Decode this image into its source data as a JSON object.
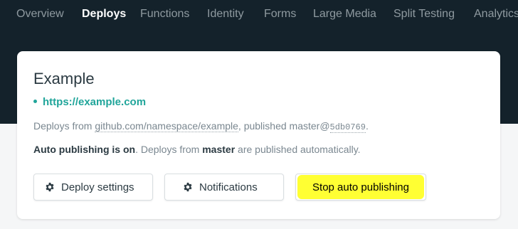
{
  "colors": {
    "top_background": "#14222b",
    "accent_teal": "#20a59a",
    "highlight_yellow": "#ffff33"
  },
  "nav": {
    "items": [
      {
        "label": "Overview"
      },
      {
        "label": "Deploys",
        "active": true
      },
      {
        "label": "Functions"
      },
      {
        "label": "Identity"
      },
      {
        "label": "Forms"
      },
      {
        "label": "Large Media"
      },
      {
        "label": "Split Testing"
      },
      {
        "label": "Analytics"
      }
    ]
  },
  "site": {
    "name": "Example",
    "url": "https://example.com"
  },
  "deploy_info": {
    "prefix": "Deploys from ",
    "repo": "github.com/namespace/example",
    "middle": ", published ",
    "branch_at": "master@",
    "commit": "5db0769",
    "suffix": "."
  },
  "auto_publishing": {
    "status_strong": "Auto publishing is on",
    "text_1": ". Deploys from ",
    "branch": "master",
    "text_2": " are published automatically."
  },
  "buttons": {
    "deploy_settings": {
      "label": "Deploy settings",
      "icon": "gear-icon"
    },
    "notifications": {
      "label": "Notifications",
      "icon": "gear-icon"
    },
    "stop_auto_publishing": {
      "label": "Stop auto publishing",
      "highlighted": true
    }
  }
}
